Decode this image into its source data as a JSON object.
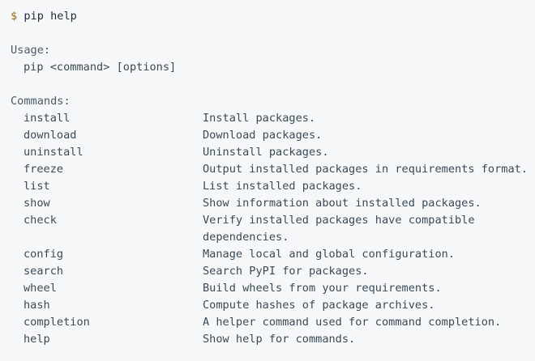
{
  "prompt": {
    "symbol": "$",
    "command": "pip help"
  },
  "usage": {
    "heading": "Usage:",
    "syntax": "pip <command> [options]"
  },
  "commands": {
    "heading": "Commands:",
    "items": [
      {
        "name": "install",
        "description": "Install packages."
      },
      {
        "name": "download",
        "description": "Download packages."
      },
      {
        "name": "uninstall",
        "description": "Uninstall packages."
      },
      {
        "name": "freeze",
        "description": "Output installed packages in requirements format."
      },
      {
        "name": "list",
        "description": "List installed packages."
      },
      {
        "name": "show",
        "description": "Show information about installed packages."
      },
      {
        "name": "check",
        "description": "Verify installed packages have compatible",
        "description_cont": "dependencies."
      },
      {
        "name": "config",
        "description": "Manage local and global configuration."
      },
      {
        "name": "search",
        "description": "Search PyPI for packages."
      },
      {
        "name": "wheel",
        "description": "Build wheels from your requirements."
      },
      {
        "name": "hash",
        "description": "Compute hashes of package archives."
      },
      {
        "name": "completion",
        "description": "A helper command used for command completion."
      },
      {
        "name": "help",
        "description": "Show help for commands."
      }
    ]
  },
  "colors": {
    "background": "#f6f7f8",
    "text": "#3b4a57",
    "prompt_symbol": "#9a6b1c"
  }
}
